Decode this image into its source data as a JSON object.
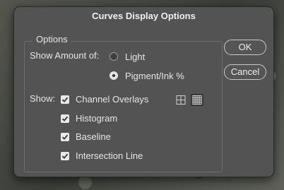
{
  "dialog": {
    "title": "Curves Display Options"
  },
  "options_group": {
    "legend": "Options"
  },
  "show_amount": {
    "label": "Show Amount of:",
    "choices": [
      {
        "label": "Light",
        "selected": false
      },
      {
        "label": "Pigment/Ink %",
        "selected": true
      }
    ]
  },
  "show": {
    "label": "Show:",
    "items": [
      {
        "label": "Channel Overlays",
        "checked": true
      },
      {
        "label": "Histogram",
        "checked": true
      },
      {
        "label": "Baseline",
        "checked": true
      },
      {
        "label": "Intersection Line",
        "checked": true
      }
    ],
    "grid_options": [
      {
        "name": "simple-grid",
        "active": false
      },
      {
        "name": "detailed-grid",
        "active": true
      }
    ]
  },
  "buttons": {
    "ok": "OK",
    "cancel": "Cancel"
  }
}
